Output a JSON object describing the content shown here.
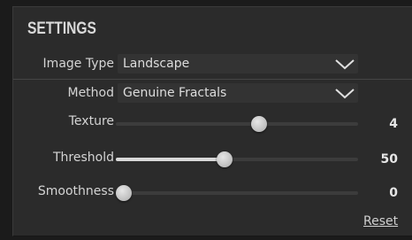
{
  "panel": {
    "title": "SETTINGS"
  },
  "image_type": {
    "label": "Image Type",
    "value": "Landscape",
    "chevron_icon": "chevron-down-icon"
  },
  "method": {
    "label": "Method",
    "value": "Genuine Fractals",
    "chevron_icon": "chevron-down-icon"
  },
  "sliders": [
    {
      "label": "Texture",
      "value": "4",
      "fraction": 0.59,
      "filled": false
    },
    {
      "label": "Threshold",
      "value": "50",
      "fraction": 0.45,
      "filled": true
    },
    {
      "label": "Smoothness",
      "value": "0",
      "fraction": 0.0,
      "filled": false
    }
  ],
  "reset_label": "Reset",
  "colors": {
    "panel_bg": "#2b2b2b",
    "dropdown_bg": "#333333",
    "track": "#3c3c3c",
    "fill": "#d8d8d8"
  }
}
